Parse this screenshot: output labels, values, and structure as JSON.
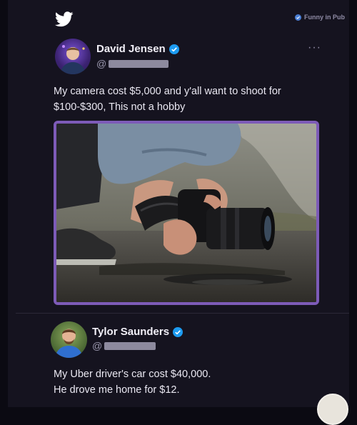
{
  "colors": {
    "brand": "#1d9bf0",
    "photo_border": "#7d5bb8",
    "background": "#15131f"
  },
  "header": {
    "logo_icon": "twitter-bird-icon",
    "watermark": "Funny in Pub"
  },
  "tweet": {
    "author": "David Jensen",
    "handle_prefix": "@",
    "more_label": "···",
    "text": "My camera cost $5,000 and y'all want to shoot for $100-$300, This not a hobby"
  },
  "reply": {
    "author": "Tylor Saunders",
    "handle_prefix": "@",
    "text_line1": "My Uber driver's car cost $40,000.",
    "text_line2": "He drove me home for $12."
  }
}
